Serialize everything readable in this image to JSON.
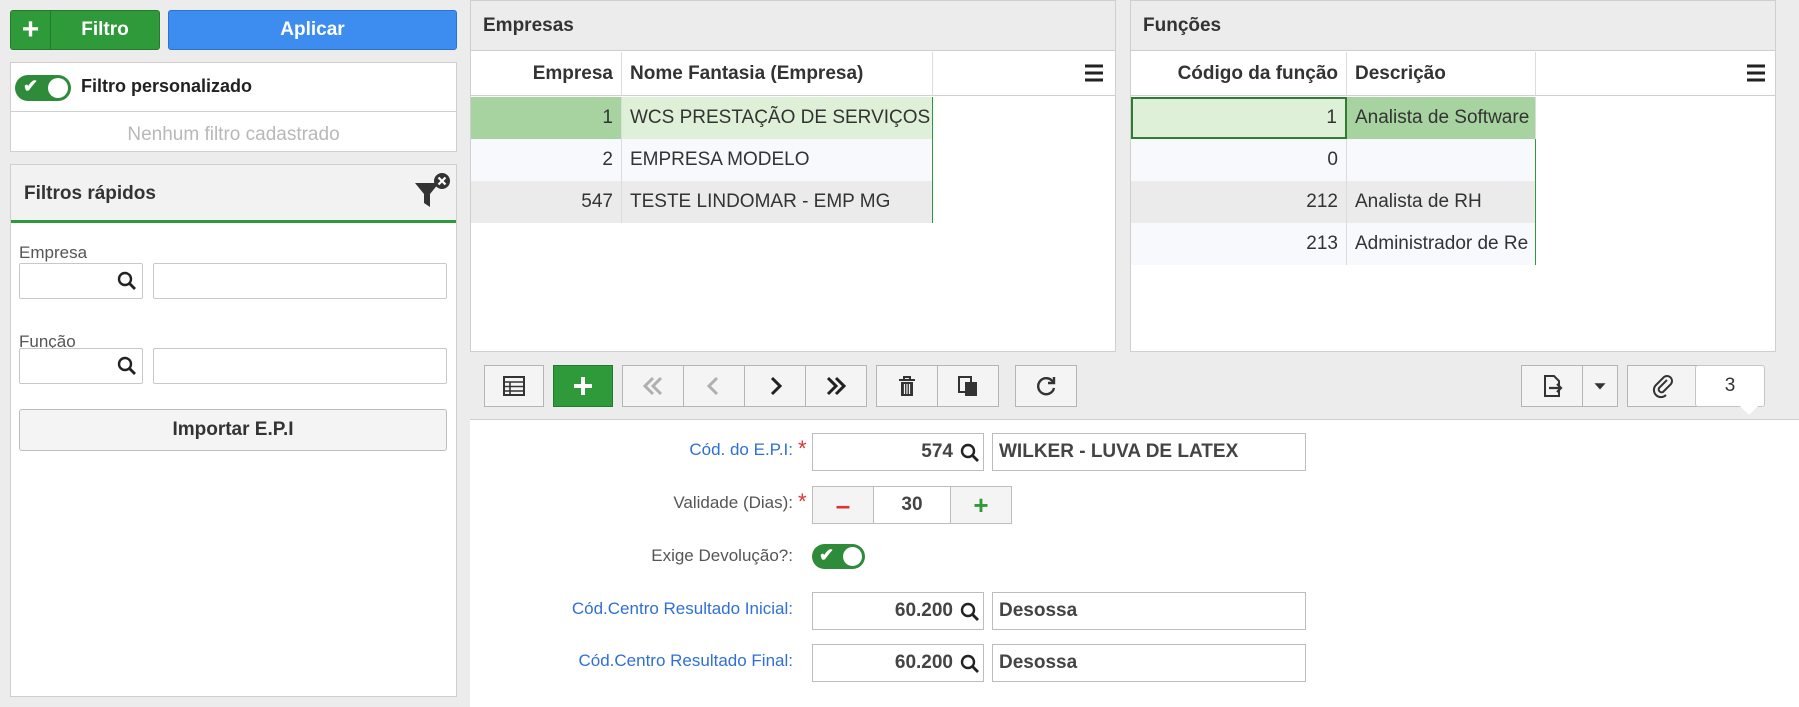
{
  "filter_bar": {
    "filter_label": "Filtro",
    "apply_label": "Aplicar"
  },
  "custom_filter": {
    "label": "Filtro personalizado",
    "enabled": true,
    "empty_text": "Nenhum filtro cadastrado"
  },
  "quick_filters": {
    "title": "Filtros rápidos",
    "empresa_label": "Empresa",
    "funcao_label": "Função",
    "import_label": "Importar E.P.I"
  },
  "empresas": {
    "title": "Empresas",
    "columns": [
      "Empresa",
      "Nome Fantasia (Empresa)"
    ],
    "rows": [
      {
        "code": "1",
        "name": "WCS PRESTAÇÃO DE SERVIÇOS"
      },
      {
        "code": "2",
        "name": "EMPRESA MODELO"
      },
      {
        "code": "547",
        "name": "TESTE LINDOMAR - EMP MG"
      }
    ]
  },
  "funcoes": {
    "title": "Funções",
    "columns": [
      "Código da função",
      "Descrição"
    ],
    "rows": [
      {
        "code": "1",
        "desc": "Analista de Software"
      },
      {
        "code": "0",
        "desc": ""
      },
      {
        "code": "212",
        "desc": "Analista de RH"
      },
      {
        "code": "213",
        "desc": "Administrador de Re"
      }
    ]
  },
  "toolbar": {
    "record_count": "3"
  },
  "form": {
    "cod_epi_label": "Cód. do E.P.I:",
    "cod_epi_value": "574",
    "epi_desc": "WILKER - LUVA DE LATEX",
    "validade_label": "Validade (Dias):",
    "validade_value": "30",
    "devolucao_label": "Exige Devolução?:",
    "devolucao_enabled": true,
    "centro_inicial_label": "Cód.Centro Resultado Inicial:",
    "centro_inicial_value": "60.200",
    "centro_inicial_desc": "Desossa",
    "centro_final_label": "Cód.Centro Resultado Final:",
    "centro_final_value": "60.200",
    "centro_final_desc": "Desossa"
  },
  "colors": {
    "green": "#2e9a3a",
    "blue": "#3d8df0",
    "link_blue": "#2f6fd6",
    "selected_row": "#a7d3a0",
    "required": "#dd3333"
  }
}
